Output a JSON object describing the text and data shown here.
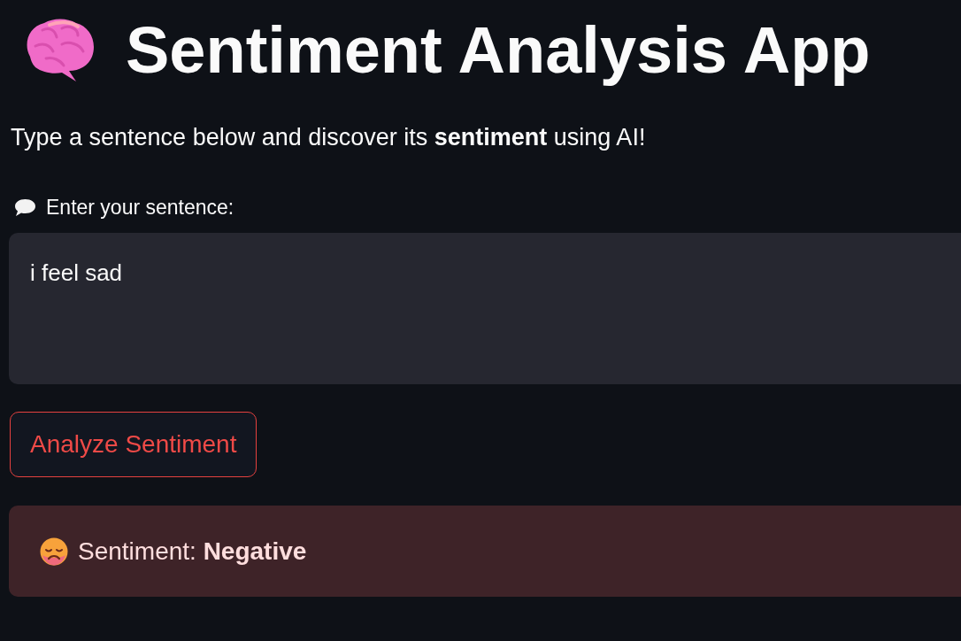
{
  "header": {
    "title": "Sentiment Analysis App"
  },
  "intro": "Type a sentence below and discover its **sentiment** using AI!",
  "input": {
    "label": "Enter your sentence:",
    "value": "i feel sad"
  },
  "button": {
    "label": "Analyze Sentiment"
  },
  "result": {
    "kind": "error",
    "text": "Sentiment: **Negative**"
  }
}
